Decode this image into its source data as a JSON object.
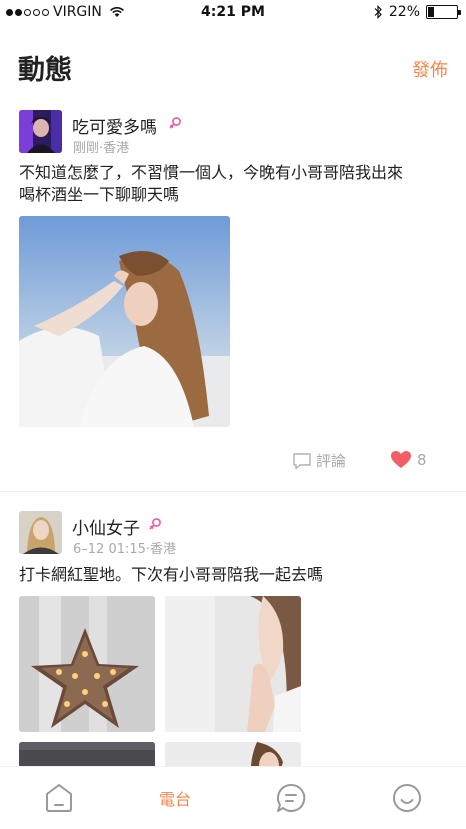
{
  "status_bar": {
    "carrier": "VIRGIN",
    "time": "4:21 PM",
    "battery": "22%",
    "battery_level": 0.22,
    "signal_bars_filled": 2,
    "signal_bars_total": 5
  },
  "header": {
    "title": "動態",
    "publish_label": "發佈",
    "accent_color": "#f4874b"
  },
  "posts": [
    {
      "username": "吃可愛多嗎",
      "meta": "剛剛·香港",
      "text_line1": "不知道怎麼了，不習慣一個人，今晚有小哥哥陪我出來",
      "text_line2": "喝杯酒坐一下聊聊天嗎",
      "comment_label": "評論",
      "like_count": "8",
      "photo_count": 1
    },
    {
      "username": "小仙女子",
      "meta": "6–12 01:15·香港",
      "text_line1": "打卡網紅聖地。下次有小哥哥陪我一起去嗎",
      "photo_count": 4
    }
  ],
  "bottom_nav": {
    "items": [
      {
        "icon": "home-icon"
      },
      {
        "label": "電台",
        "active": true
      },
      {
        "icon": "chat-icon"
      },
      {
        "icon": "profile-icon"
      }
    ]
  },
  "colors": {
    "accent": "#f4874b",
    "like": "#f25e63",
    "female_gender": "#e85aa6"
  }
}
